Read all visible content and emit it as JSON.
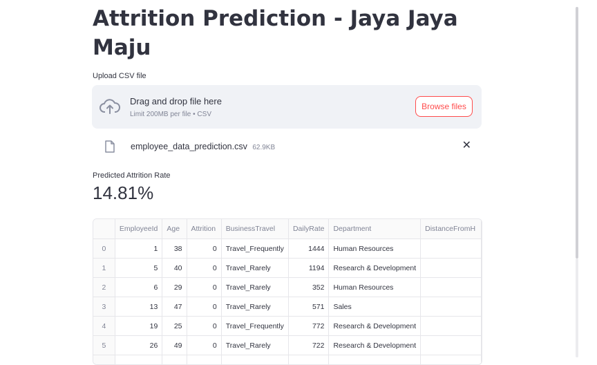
{
  "page": {
    "title": "Attrition Prediction - Jaya Jaya Maju"
  },
  "uploader": {
    "label": "Upload CSV file",
    "drop_text": "Drag and drop file here",
    "limit_text": "Limit 200MB per file • CSV",
    "browse_label": "Browse files",
    "icon": "cloud-upload-icon"
  },
  "uploaded_file": {
    "name": "employee_data_prediction.csv",
    "size": "62.9KB",
    "icon": "file-icon",
    "remove_icon": "close-icon"
  },
  "metric": {
    "label": "Predicted Attrition Rate",
    "value": "14.81%"
  },
  "table": {
    "columns": [
      "",
      "EmployeeId",
      "Age",
      "Attrition",
      "BusinessTravel",
      "DailyRate",
      "Department",
      "DistanceFromH"
    ],
    "rows": [
      [
        "0",
        "1",
        "38",
        "0",
        "Travel_Frequently",
        "1444",
        "Human Resources",
        ""
      ],
      [
        "1",
        "5",
        "40",
        "0",
        "Travel_Rarely",
        "1194",
        "Research & Development",
        ""
      ],
      [
        "2",
        "6",
        "29",
        "0",
        "Travel_Rarely",
        "352",
        "Human Resources",
        ""
      ],
      [
        "3",
        "13",
        "47",
        "0",
        "Travel_Rarely",
        "571",
        "Sales",
        ""
      ],
      [
        "4",
        "19",
        "25",
        "0",
        "Travel_Frequently",
        "772",
        "Research & Development",
        ""
      ],
      [
        "5",
        "26",
        "49",
        "0",
        "Travel_Rarely",
        "722",
        "Research & Development",
        ""
      ],
      [
        "",
        "",
        "",
        "",
        "",
        "",
        "",
        ""
      ]
    ]
  },
  "colors": {
    "accent": "#ff4b4b",
    "text": "#31333f",
    "muted": "#808495",
    "dropzone_bg": "#f0f2f6"
  }
}
